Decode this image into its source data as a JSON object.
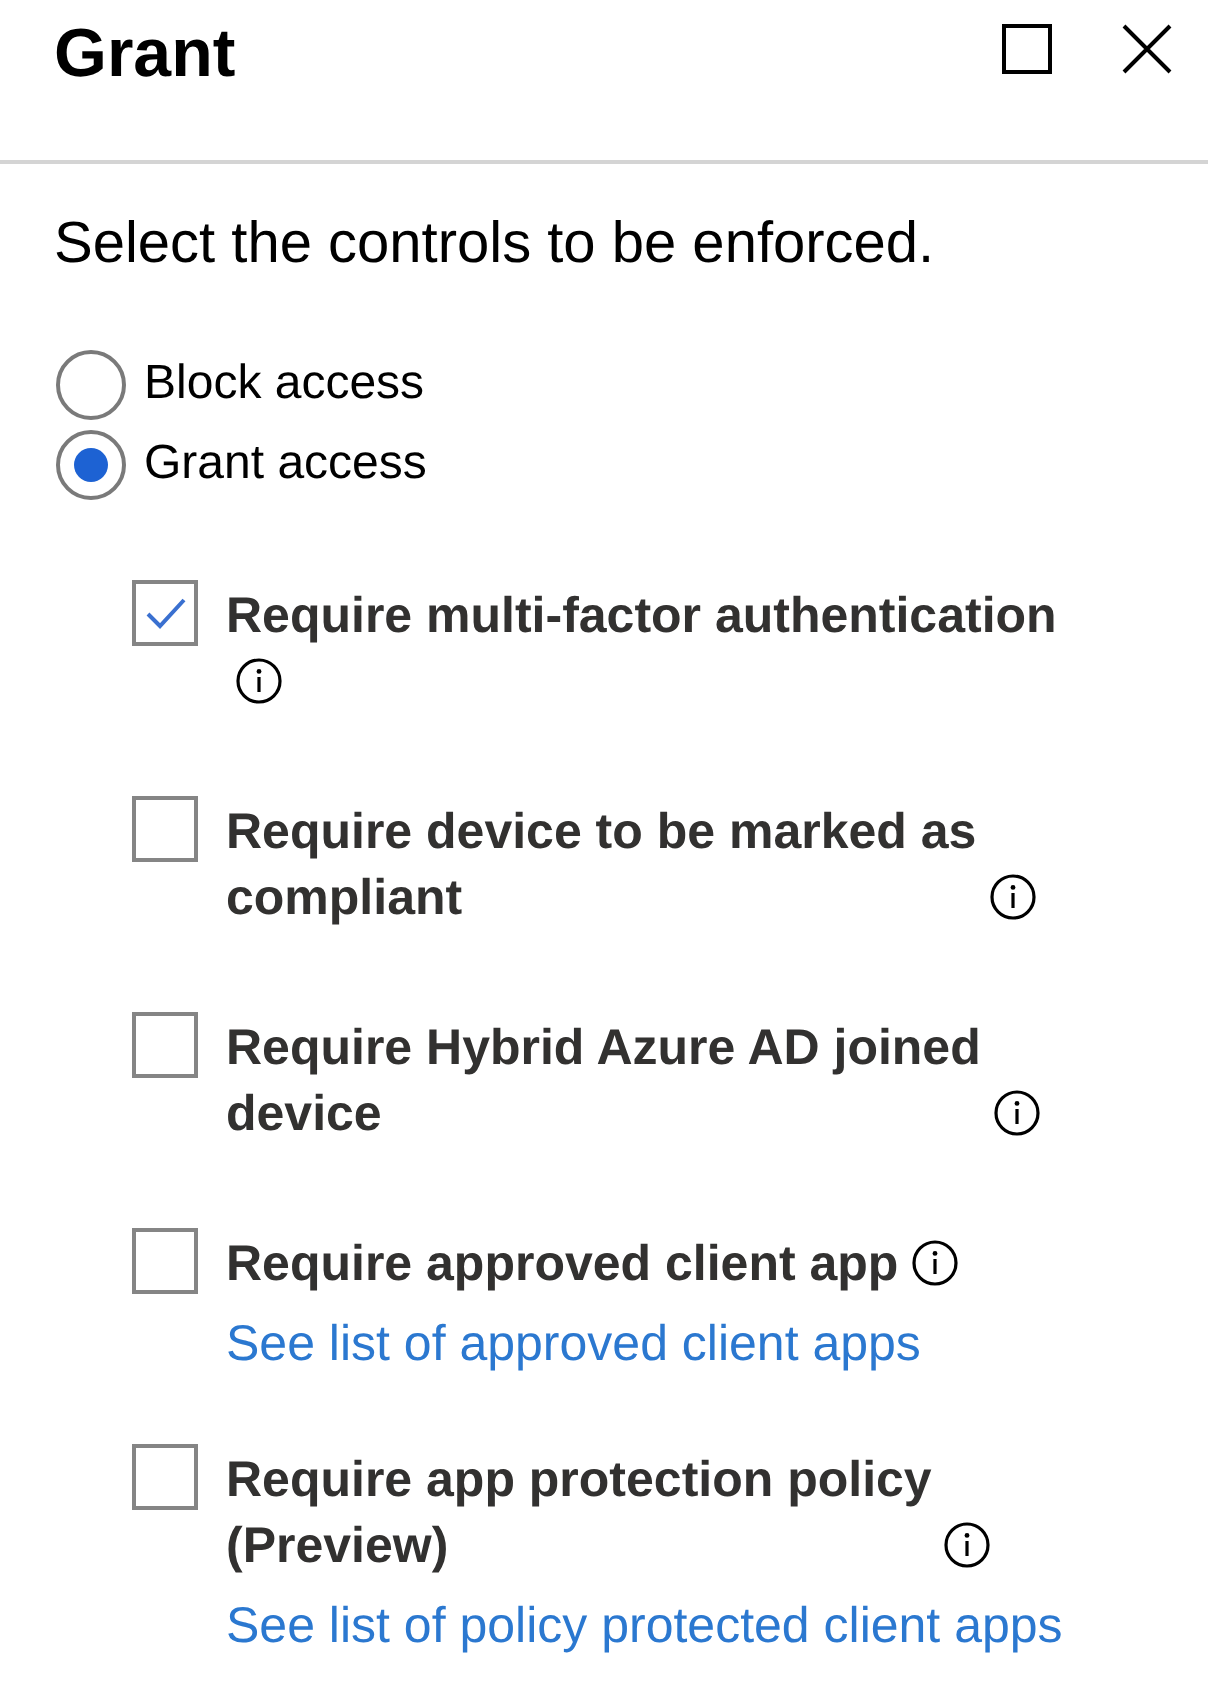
{
  "panel": {
    "title": "Grant"
  },
  "instruction": "Select the controls to be enforced.",
  "access_options": [
    {
      "label": "Block access",
      "selected": false
    },
    {
      "label": "Grant access",
      "selected": true
    }
  ],
  "controls": [
    {
      "label": "Require multi-factor authentication",
      "checked": true
    },
    {
      "label": "Require device to be marked as compliant",
      "checked": false
    },
    {
      "label": "Require Hybrid Azure AD joined device",
      "checked": false
    },
    {
      "label": "Require approved client app",
      "checked": false,
      "link": "See list of approved client apps"
    },
    {
      "label": "Require app protection policy (Preview)",
      "checked": false,
      "link": "See list of policy protected client apps"
    }
  ]
}
